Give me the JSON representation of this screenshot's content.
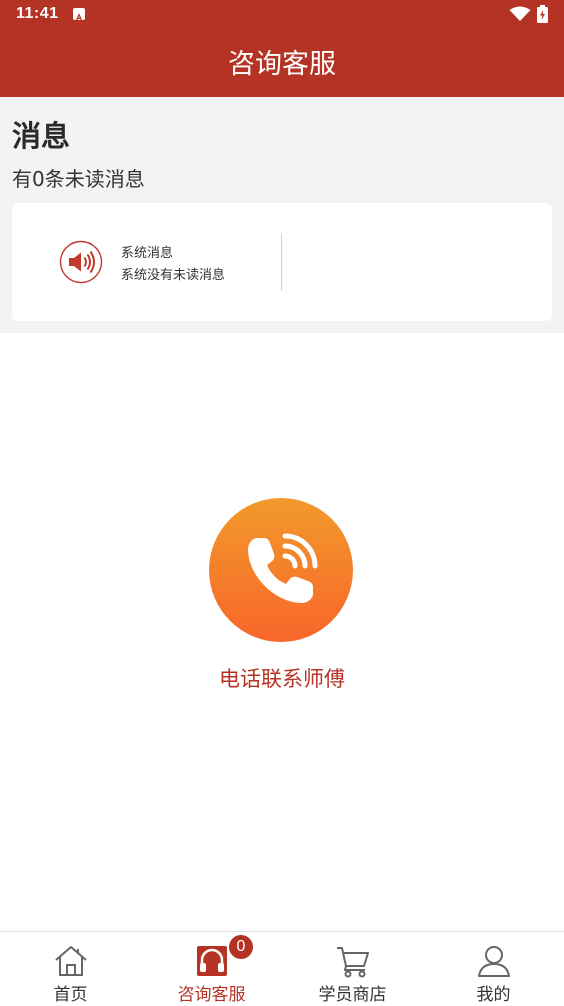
{
  "status_bar": {
    "time": "11:41"
  },
  "header": {
    "title": "咨询客服"
  },
  "messages": {
    "heading": "消息",
    "unread_summary": "有0条未读消息",
    "card": {
      "icon": "speaker-icon",
      "title": "系统消息",
      "subtitle": "系统没有未读消息"
    }
  },
  "contact": {
    "icon": "phone-icon",
    "label": "电话联系师傅"
  },
  "bottom_nav": {
    "items": [
      {
        "label": "首页",
        "icon": "home-icon"
      },
      {
        "label": "咨询客服",
        "icon": "headset-icon",
        "active": true,
        "badge": "0"
      },
      {
        "label": "学员商店",
        "icon": "cart-icon"
      },
      {
        "label": "我的",
        "icon": "user-icon"
      }
    ]
  },
  "colors": {
    "brand": "#b53324",
    "phone_gradient_top": "#f29a2b",
    "phone_gradient_bottom": "#f7662a",
    "section_bg": "#f3f3f3"
  }
}
